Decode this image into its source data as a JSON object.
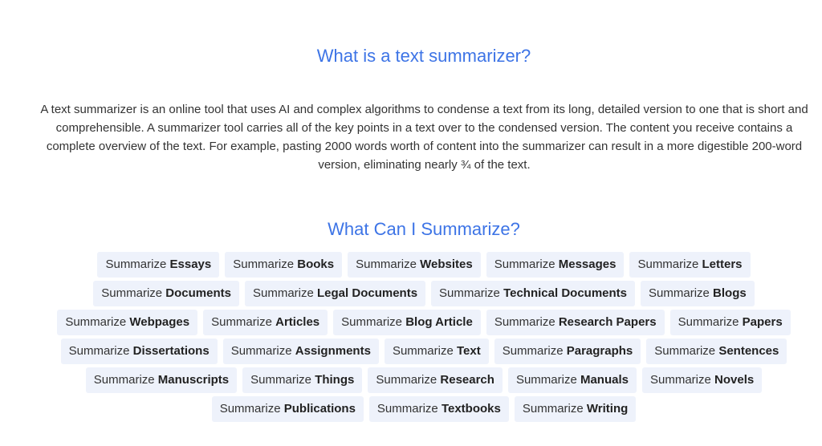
{
  "section_about": {
    "heading": "What is a text summarizer?",
    "paragraph": "A text summarizer is an online tool that uses AI and complex algorithms to condense a text from its long, detailed version to one that is short and comprehensible. A summarizer tool carries all of the key points in a text over to the condensed version. The content you receive contains a complete overview of the text. For example, pasting 2000 words worth of content into the summarizer can result in a more digestible 200-word version, eliminating nearly ¾ of the text."
  },
  "section_tags": {
    "heading": "What Can I Summarize?",
    "prefix": "Summarize",
    "tags": [
      "Essays",
      "Books",
      "Websites",
      "Messages",
      "Letters",
      "Documents",
      "Legal Documents",
      "Technical Documents",
      "Blogs",
      "Webpages",
      "Articles",
      "Blog Article",
      "Research Papers",
      "Papers",
      "Dissertations",
      "Assignments",
      "Text",
      "Paragraphs",
      "Sentences",
      "Manuscripts",
      "Things",
      "Research",
      "Manuals",
      "Novels",
      "Publications",
      "Textbooks",
      "Writing"
    ]
  },
  "colors": {
    "heading": "#3d74e6",
    "tag_background": "#eef2fb",
    "text": "#333333"
  }
}
